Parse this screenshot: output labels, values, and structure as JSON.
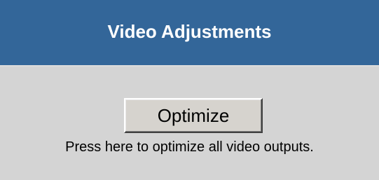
{
  "header": {
    "title": "Video Adjustments"
  },
  "main": {
    "optimize_button_label": "Optimize",
    "help_text": "Press here to optimize all video outputs."
  },
  "colors": {
    "header_background": "#336699",
    "panel_background": "#d4d4d4",
    "button_face": "#d6d3ce"
  }
}
